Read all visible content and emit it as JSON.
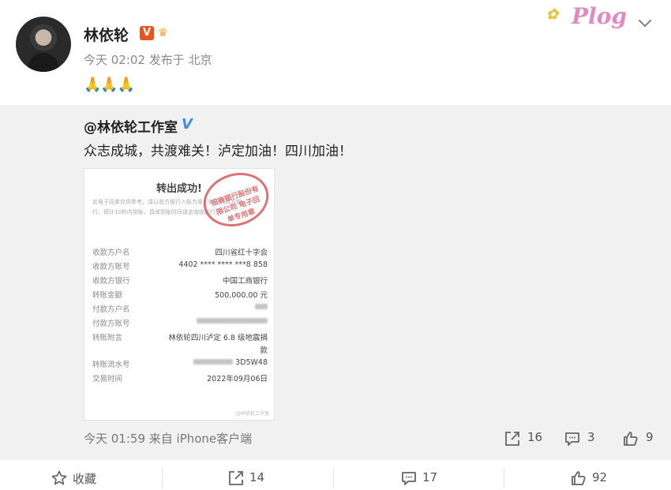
{
  "post": {
    "author": "林依轮",
    "vip_badge": "V",
    "crown_badge": "♛",
    "meta": "今天 02:02 发布于 北京",
    "emojis": "🙏🙏🙏",
    "sticker": "Plog"
  },
  "repost": {
    "author": "@林依轮工作室",
    "verified": "V",
    "text": "众志成城，共渡难关！泸定加油！四川加油！",
    "footer": "今天 01:59 来自 iPhone客户端",
    "stats": {
      "repost_count": "16",
      "comment_count": "3",
      "like_count": "9"
    }
  },
  "receipt": {
    "title": "转出成功!",
    "note": "此电子回单仅供参考。请以收方银行入账为准，如已到对方银行，预计10秒内到账，具体到账时间请咨询收款行。",
    "stamp": "招商银行股份有限公司 电子回单专用章",
    "rows": [
      {
        "label": "收款方户名",
        "value": "四川省红十字会"
      },
      {
        "label": "收款方账号",
        "value": "4402 **** **** ***8 858"
      },
      {
        "label": "收款方银行",
        "value": "中国工商银行"
      },
      {
        "label": "转账金额",
        "value": "500,000.00 元"
      },
      {
        "label": "付款方户名",
        "value": ""
      },
      {
        "label": "付款方账号",
        "value": ""
      },
      {
        "label": "转账附言",
        "value": "林依轮四川泸定 6.8 级地震捐"
      },
      {
        "label": "",
        "value": "款"
      },
      {
        "label": "转账流水号",
        "value": "3D5W48"
      },
      {
        "label": "交易时间",
        "value": "2022年09月06日"
      }
    ],
    "watermark": "@林依轮工作室"
  },
  "actions": {
    "favorite_label": "收藏",
    "repost_count": "14",
    "comment_count": "17",
    "like_count": "92"
  },
  "colors": {
    "accent_orange": "#e8541e",
    "verified_blue": "#3d8fe0",
    "stamp_red": "#d85a5f"
  }
}
